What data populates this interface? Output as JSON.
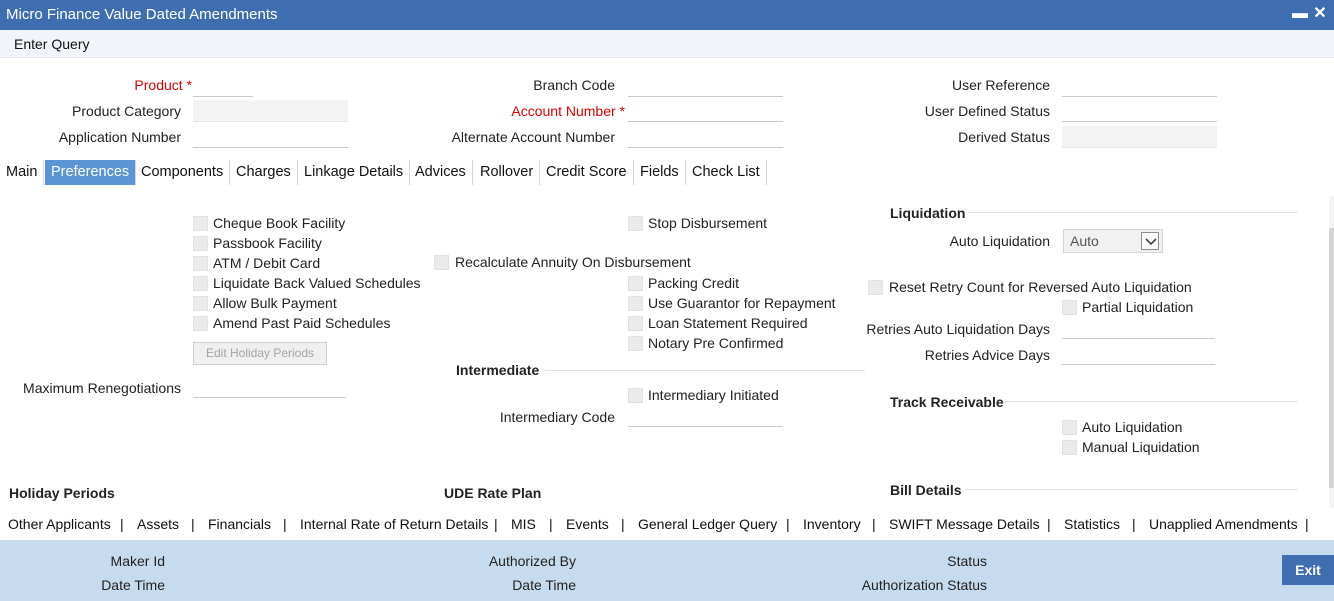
{
  "window": {
    "title": "Micro Finance Value Dated Amendments",
    "minimize_glyph": "▬",
    "close_glyph": "✕"
  },
  "toolbar": {
    "enter_query": "Enter Query"
  },
  "header": {
    "product_label": "Product",
    "product_category_label": "Product Category",
    "application_number_label": "Application Number",
    "branch_code_label": "Branch Code",
    "account_number_label": "Account Number",
    "alternate_account_number_label": "Alternate Account Number",
    "user_reference_label": "User Reference",
    "user_defined_status_label": "User Defined Status",
    "derived_status_label": "Derived Status",
    "required_marker": "*"
  },
  "tabs": [
    "Main",
    "Preferences",
    "Components",
    "Charges",
    "Linkage Details",
    "Advices",
    "Rollover",
    "Credit Score",
    "Fields",
    "Check List"
  ],
  "preferences": {
    "col1": [
      "Cheque Book Facility",
      "Passbook Facility",
      "ATM / Debit Card",
      "Liquidate Back Valued Schedules",
      "Allow Bulk Payment",
      "Amend Past Paid Schedules"
    ],
    "edit_holiday_periods": "Edit Holiday Periods",
    "maximum_renegotiations_label": "Maximum Renegotiations",
    "stop_disbursement": "Stop Disbursement",
    "recalculate_annuity": "Recalculate Annuity On Disbursement",
    "col2": [
      "Packing Credit",
      "Use Guarantor for Repayment",
      "Loan Statement Required",
      "Notary Pre Confirmed"
    ],
    "intermediate_heading": "Intermediate",
    "intermediary_initiated": "Intermediary Initiated",
    "intermediary_code_label": "Intermediary Code",
    "liquidation_heading": "Liquidation",
    "auto_liquidation_label": "Auto Liquidation",
    "auto_liquidation_value": "Auto",
    "reset_retry": "Reset Retry Count for Reversed Auto Liquidation",
    "partial_liquidation": "Partial Liquidation",
    "retries_auto_liq_days_label": "Retries Auto Liquidation Days",
    "retries_advice_days_label": "Retries Advice Days",
    "track_receivable_heading": "Track Receivable",
    "tr_auto_liquidation": "Auto Liquidation",
    "tr_manual_liquidation": "Manual Liquidation",
    "holiday_periods_heading": "Holiday Periods",
    "ude_rate_plan_heading": "UDE Rate Plan",
    "bill_details_heading": "Bill Details"
  },
  "bottom_links": [
    "Other Applicants",
    "Assets",
    "Financials",
    "Internal Rate of Return Details",
    "MIS",
    "Events",
    "General Ledger Query",
    "Inventory",
    "SWIFT Message Details",
    "Statistics",
    "Unapplied Amendments"
  ],
  "bottom_sep": "|",
  "footer": {
    "maker_id": "Maker Id",
    "date_time_1": "Date Time",
    "authorized_by": "Authorized By",
    "date_time_2": "Date Time",
    "status": "Status",
    "authorization_status": "Authorization Status",
    "exit": "Exit"
  },
  "colors": {
    "title_bar": "#3f6eb0",
    "active_tab": "#5c95d4",
    "footer": "#c7dbee",
    "required": "#e00000"
  }
}
